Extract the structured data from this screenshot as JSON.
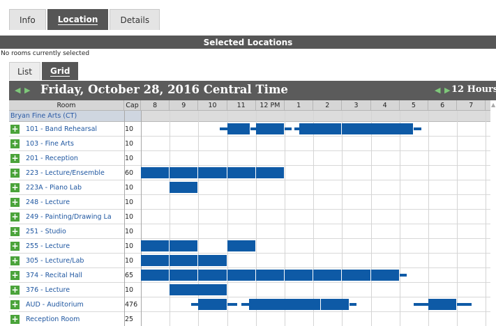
{
  "top_tabs": [
    "Info",
    "Location",
    "Details"
  ],
  "top_active": 1,
  "selected_header": "Selected Locations",
  "no_rooms_text": "No rooms currently selected",
  "view_tabs": [
    "List",
    "Grid"
  ],
  "view_active": 1,
  "date_title": "Friday, October 28, 2016 Central Time",
  "hours_label": "12 Hours",
  "columns": {
    "room": "Room",
    "cap": "Cap"
  },
  "hours": [
    "8",
    "9",
    "10",
    "11",
    "12 PM",
    "1",
    "2",
    "3",
    "4",
    "5",
    "6",
    "7"
  ],
  "group": "Bryan Fine Arts (CT)",
  "rooms": [
    {
      "name": "101 - Band Rehearsal",
      "cap": "10"
    },
    {
      "name": "103 - Fine Arts",
      "cap": "10"
    },
    {
      "name": "201 - Reception",
      "cap": "10"
    },
    {
      "name": "223 - Lecture/Ensemble",
      "cap": "60"
    },
    {
      "name": "223A - Piano Lab",
      "cap": "10"
    },
    {
      "name": "248 - Lecture",
      "cap": "10"
    },
    {
      "name": "249 - Painting/Drawing La",
      "cap": "10"
    },
    {
      "name": "251 - Studio",
      "cap": "10"
    },
    {
      "name": "255 - Lecture",
      "cap": "10"
    },
    {
      "name": "305 - Lecture/Lab",
      "cap": "10"
    },
    {
      "name": "374 - Recital Hall",
      "cap": "65"
    },
    {
      "name": "376 - Lecture",
      "cap": "10"
    },
    {
      "name": "AUD - Auditorium",
      "cap": "476"
    },
    {
      "name": "Reception Room",
      "cap": "25"
    }
  ],
  "bookings": [
    {
      "row": 0,
      "start": 11.0,
      "end": 11.8,
      "bar_start": 10.75,
      "bar_end": 12.15
    },
    {
      "row": 0,
      "start": 12.0,
      "end": 13.0,
      "bar_start": 12.0,
      "bar_end": 13.25
    },
    {
      "row": 0,
      "start": 13.5,
      "end": 15.0,
      "bar_start": 13.35,
      "bar_end": 15.0
    },
    {
      "row": 0,
      "start": 15.0,
      "end": 17.5,
      "bar_start": 15.0,
      "bar_end": 17.75
    },
    {
      "row": 3,
      "start": 8.0,
      "end": 9.0
    },
    {
      "row": 3,
      "start": 9.0,
      "end": 10.0
    },
    {
      "row": 3,
      "start": 10.0,
      "end": 11.0
    },
    {
      "row": 3,
      "start": 11.0,
      "end": 12.0
    },
    {
      "row": 3,
      "start": 12.0,
      "end": 13.0
    },
    {
      "row": 4,
      "start": 9.0,
      "end": 10.0
    },
    {
      "row": 8,
      "start": 8.0,
      "end": 9.0
    },
    {
      "row": 8,
      "start": 9.0,
      "end": 10.0
    },
    {
      "row": 8,
      "start": 11.0,
      "end": 12.0
    },
    {
      "row": 9,
      "start": 8.0,
      "end": 9.0
    },
    {
      "row": 9,
      "start": 9.0,
      "end": 10.0
    },
    {
      "row": 9,
      "start": 10.0,
      "end": 11.0
    },
    {
      "row": 10,
      "start": 8.0,
      "end": 9.0
    },
    {
      "row": 10,
      "start": 9.0,
      "end": 10.0
    },
    {
      "row": 10,
      "start": 10.0,
      "end": 11.0
    },
    {
      "row": 10,
      "start": 11.0,
      "end": 12.0
    },
    {
      "row": 10,
      "start": 12.0,
      "end": 13.0
    },
    {
      "row": 10,
      "start": 13.0,
      "end": 14.0
    },
    {
      "row": 10,
      "start": 14.0,
      "end": 15.0
    },
    {
      "row": 10,
      "start": 15.0,
      "end": 16.0
    },
    {
      "row": 10,
      "start": 16.0,
      "end": 17.0,
      "bar_start": 16.0,
      "bar_end": 17.25
    },
    {
      "row": 11,
      "start": 9.0,
      "end": 11.0
    },
    {
      "row": 12,
      "start": 10.0,
      "end": 11.0,
      "bar_start": 9.75,
      "bar_end": 11.35
    },
    {
      "row": 12,
      "start": 11.75,
      "end": 14.25,
      "bar_start": 11.5,
      "bar_end": 14.25
    },
    {
      "row": 12,
      "start": 14.25,
      "end": 15.25,
      "bar_start": 14.25,
      "bar_end": 15.5
    },
    {
      "row": 12,
      "start": 18.0,
      "end": 19.0,
      "bar_start": 17.5,
      "bar_end": 19.5
    }
  ]
}
